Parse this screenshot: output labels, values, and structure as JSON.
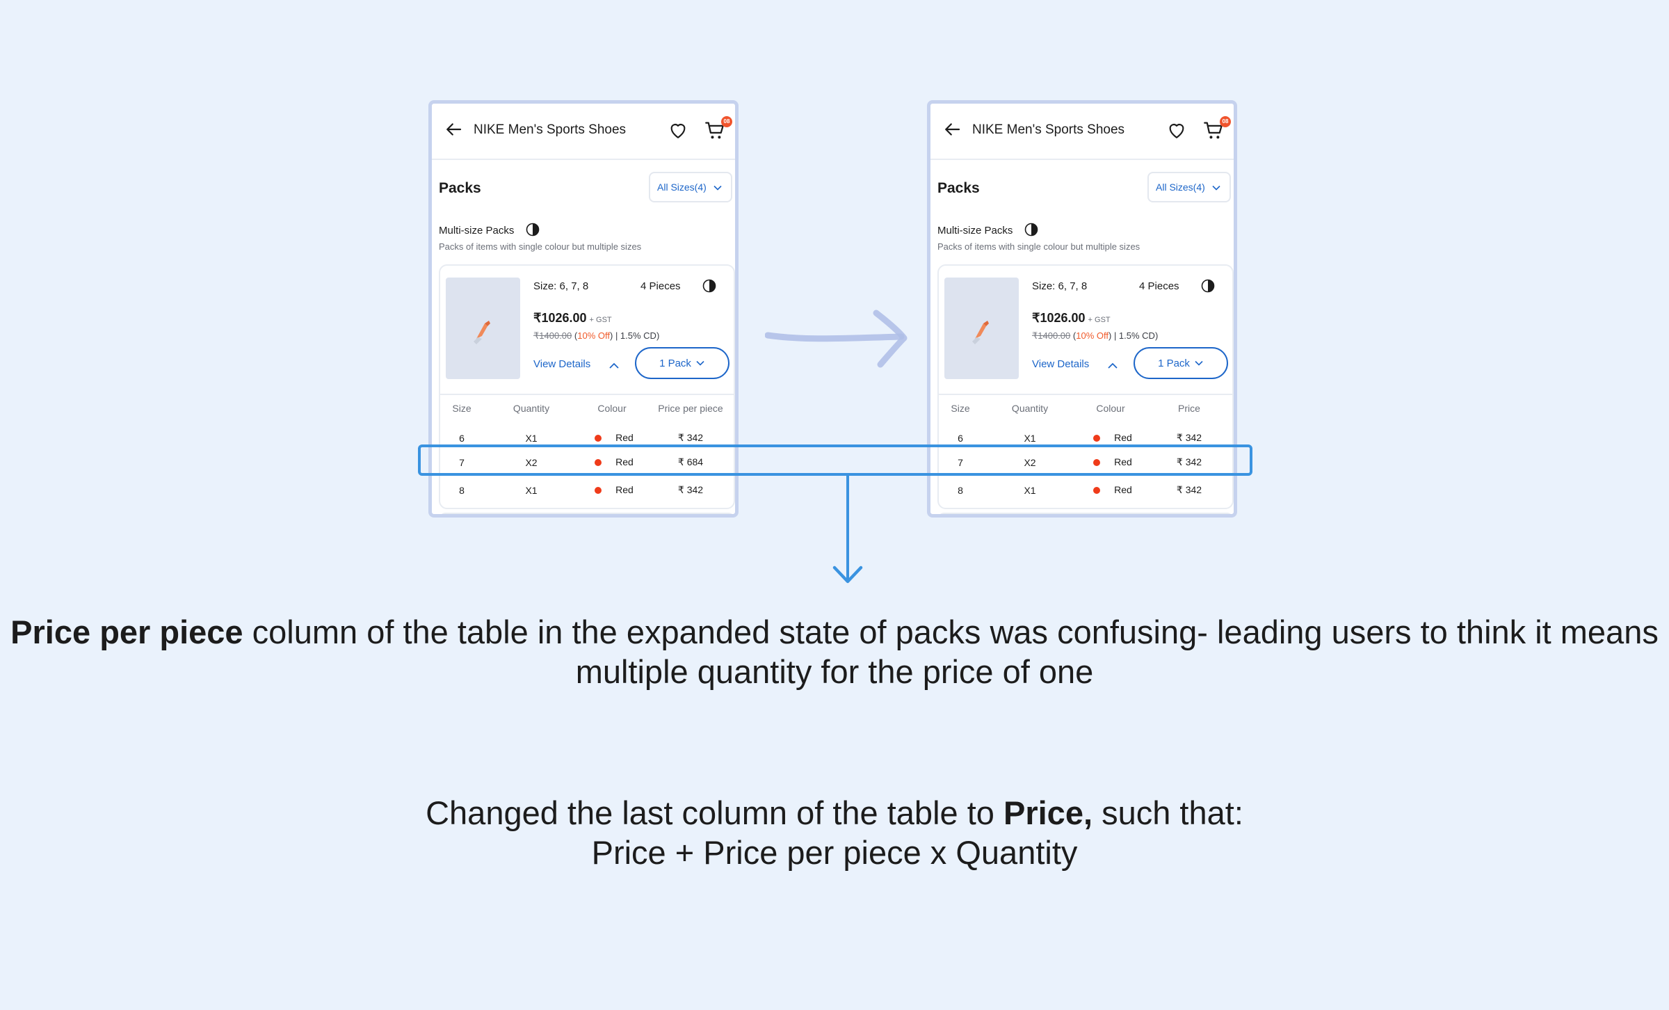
{
  "screens": [
    {
      "id": "before",
      "header": {
        "title": "NIKE Men's Sports Shoes",
        "cart_badge": "08"
      },
      "packs_heading": "Packs",
      "sizes_dropdown": "All Sizes(4)",
      "section": {
        "label": "Multi-size Packs",
        "description": "Packs of items with single colour but multiple sizes"
      },
      "card": {
        "size": "Size: 6, 7, 8",
        "pieces": "4 Pieces",
        "price": "₹1026.00",
        "gst": "+ GST",
        "old_price": "₹1400.00",
        "discount_open": "(",
        "discount": "10% Off",
        "discount_close": ")",
        "cd": "| 1.5% CD)",
        "view_details": "View Details",
        "pack_button": "1 Pack"
      },
      "table": {
        "headers": [
          "Size",
          "Quantity",
          "Colour",
          "Price per piece"
        ],
        "rows": [
          {
            "size": "6",
            "quantity": "X1",
            "colour": "Red",
            "price": "₹ 342"
          },
          {
            "size": "7",
            "quantity": "X2",
            "colour": "Red",
            "price": "₹ 684"
          },
          {
            "size": "8",
            "quantity": "X1",
            "colour": "Red",
            "price": "₹ 342"
          }
        ]
      }
    },
    {
      "id": "after",
      "header": {
        "title": "NIKE Men's Sports Shoes",
        "cart_badge": "08"
      },
      "packs_heading": "Packs",
      "sizes_dropdown": "All Sizes(4)",
      "section": {
        "label": "Multi-size Packs",
        "description": "Packs of items with single colour but multiple sizes"
      },
      "card": {
        "size": "Size: 6, 7, 8",
        "pieces": "4 Pieces",
        "price": "₹1026.00",
        "gst": "+ GST",
        "old_price": "₹1400.00",
        "discount_open": "(",
        "discount": "10% Off",
        "discount_close": ")",
        "cd": "| 1.5% CD)",
        "view_details": "View Details",
        "pack_button": "1 Pack"
      },
      "table": {
        "headers": [
          "Size",
          "Quantity",
          "Colour",
          "Price"
        ],
        "rows": [
          {
            "size": "6",
            "quantity": "X1",
            "colour": "Red",
            "price": "₹ 342"
          },
          {
            "size": "7",
            "quantity": "X2",
            "colour": "Red",
            "price": "₹ 342"
          },
          {
            "size": "8",
            "quantity": "X1",
            "colour": "Red",
            "price": "₹ 342"
          }
        ]
      }
    }
  ],
  "caption_1": {
    "bold": "Price per piece",
    "rest": " column of the table in the expanded state of packs was confusing- leading users to think it means multiple quantity for the price of one"
  },
  "caption_2": {
    "line1_pre": "Changed the last column of the table to ",
    "line1_bold": "Price,",
    "line1_post": " such that:",
    "line2": "Price + Price per piece x Quantity"
  },
  "colors": {
    "background": "#eaf2fc",
    "accent_blue": "#1d66c9",
    "highlight": "#3a93e0",
    "red_dot": "#ef3b1a",
    "discount": "#f05a2a"
  }
}
